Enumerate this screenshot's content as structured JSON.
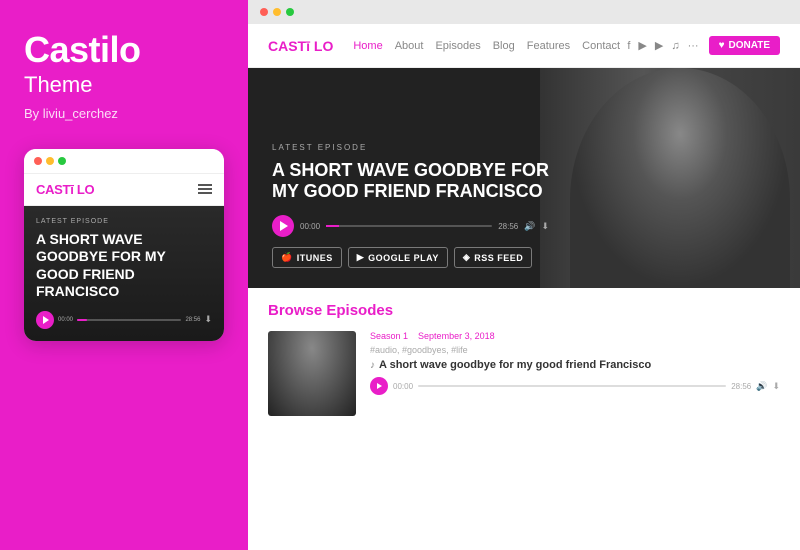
{
  "brand": {
    "name": "Castilo",
    "subtitle": "Theme",
    "author": "By liviu_cerchez"
  },
  "mobile": {
    "logo_main": "CAST",
    "logo_divider": "ī",
    "logo_suffix": "LO",
    "ep_label": "LATEST EPISODE",
    "ep_title": "A SHORT WAVE GOODBYE FOR MY GOOD FRIEND FRANCISCO",
    "time_start": "00:00",
    "time_end": "28:56"
  },
  "site": {
    "logo_main": "CAST",
    "logo_divider": "ī",
    "logo_suffix": "LO",
    "nav": [
      "Home",
      "About",
      "Episodes",
      "Blog",
      "Features",
      "Contact"
    ],
    "active_nav": 0,
    "donate_label": "DONATE"
  },
  "hero": {
    "ep_label": "LATEST EPISODE",
    "title_line1": "A SHORT WAVE GOODBYE FOR",
    "title_line2": "MY GOOD FRIEND FRANCISCO",
    "time_start": "00:00",
    "time_end": "28:56",
    "platforms": [
      {
        "icon": "apple-icon",
        "label": "ITUNES"
      },
      {
        "icon": "play-icon",
        "label": "GOOGLE PLAY"
      },
      {
        "icon": "rss-icon",
        "label": "RSS FEED"
      }
    ]
  },
  "browse": {
    "heading": "Browse",
    "heading_accent": "Episodes",
    "episode": {
      "season": "Season 1",
      "date": "September 3, 2018",
      "tags": "#audio, #goodbyes, #life",
      "title": "A short wave goodbye for my good friend Francisco",
      "time_start": "00:00",
      "time_end": "28:56"
    }
  },
  "colors": {
    "accent": "#e91ec8",
    "dark_bg": "#222222",
    "light_bg": "#ffffff"
  }
}
